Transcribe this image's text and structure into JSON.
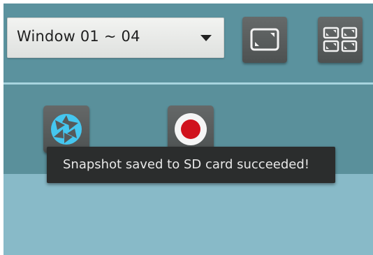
{
  "window_selector": {
    "selected": "Window 01 ~ 04"
  },
  "buttons": {
    "fullscreen_icon": "fullscreen-icon",
    "quad_view_icon": "quad-view-icon",
    "snapshot_icon": "camera-shutter-icon",
    "record_icon": "record-icon"
  },
  "toast": {
    "message": "Snapshot saved to SD card succeeded!"
  },
  "colors": {
    "background": "#5b929e",
    "lower_panel": "#88bac8",
    "snapshot_accent": "#45c6ef",
    "record_accent": "#d0121d",
    "toast_bg": "#2b2d2d"
  }
}
